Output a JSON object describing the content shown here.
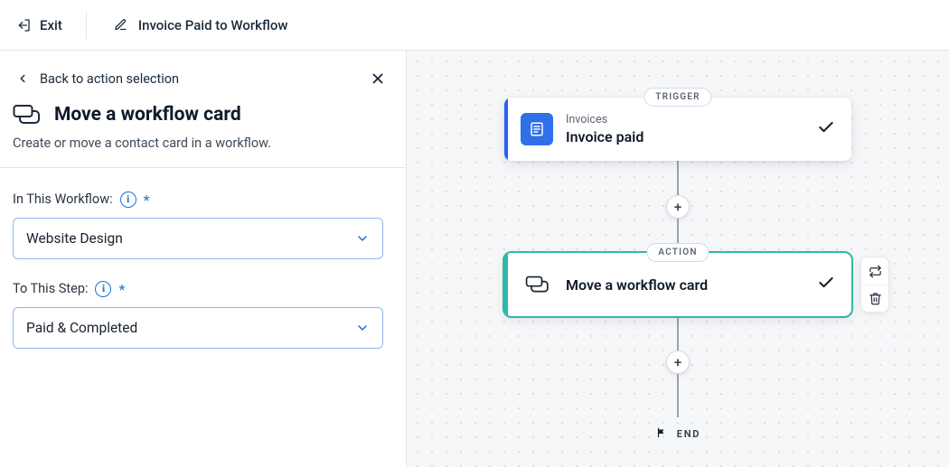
{
  "header": {
    "exit_label": "Exit",
    "title": "Invoice Paid to Workflow"
  },
  "sidebar": {
    "back_label": "Back to action selection",
    "page_title": "Move a workflow card",
    "subtitle": "Create or move a contact card in a workflow.",
    "fields": {
      "workflow": {
        "label": "In This Workflow:",
        "value": "Website Design"
      },
      "step": {
        "label": "To This Step:",
        "value": "Paid & Completed"
      }
    }
  },
  "flow": {
    "trigger": {
      "pill": "TRIGGER",
      "kicker": "Invoices",
      "title": "Invoice paid"
    },
    "action": {
      "pill": "ACTION",
      "title": "Move a workflow card"
    },
    "end_label": "END"
  }
}
